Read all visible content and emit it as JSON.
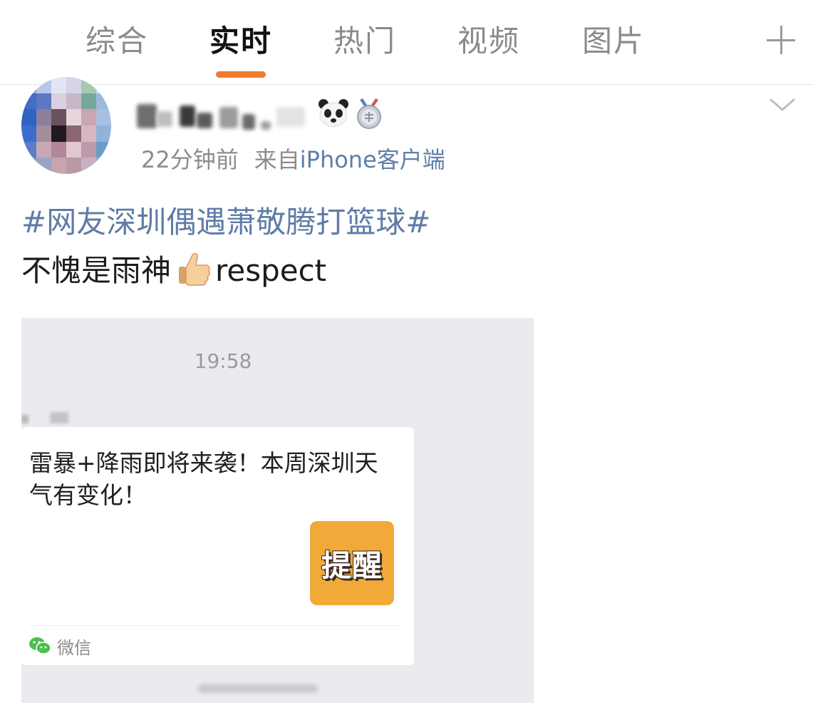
{
  "tabs": [
    {
      "label": "综合",
      "active": false
    },
    {
      "label": "实时",
      "active": true
    },
    {
      "label": "热门",
      "active": false
    },
    {
      "label": "视频",
      "active": false
    },
    {
      "label": "图片",
      "active": false
    }
  ],
  "colors": {
    "accent_indicator": "#ee7b2f",
    "link": "#5f7ca6",
    "meta_text": "#8d8d8d",
    "thumb_bg": "#f1a93a"
  },
  "post": {
    "time": "22分钟前",
    "source_prefix": "来自",
    "source_client": "iPhone客户端",
    "hashtag": "#网友深圳偶遇萧敬腾打篮球#",
    "text_before_emoji": "不愧是雨神",
    "text_after_emoji": "respect"
  },
  "embedded_image": {
    "chat_time": "19:58",
    "card_title": "雷暴+降雨即将来袭！本周深圳天气有变化！",
    "thumb_text": "提醒",
    "card_source": "微信"
  },
  "icons": [
    "panda-badge-icon",
    "medal-badge-icon",
    "chevron-down-icon",
    "add-tab-icon",
    "thumbs-up-emoji",
    "wechat-icon"
  ]
}
